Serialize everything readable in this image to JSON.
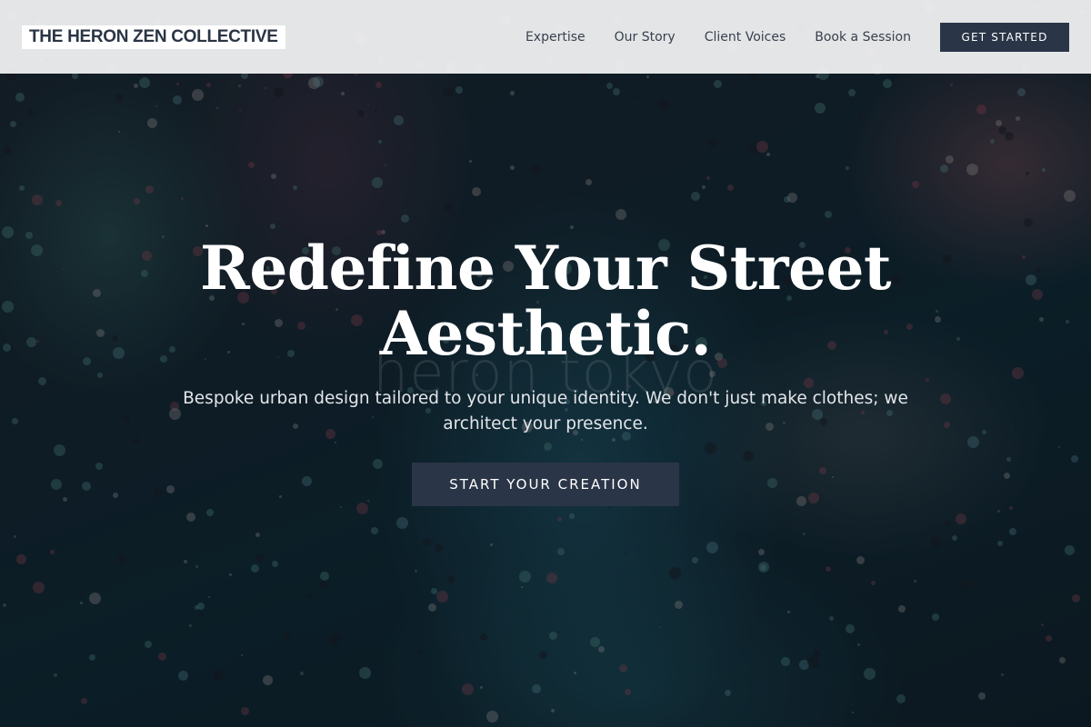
{
  "header": {
    "brand": "THE HERON ZEN COLLECTIVE",
    "nav": [
      {
        "label": "Expertise"
      },
      {
        "label": "Our Story"
      },
      {
        "label": "Client Voices"
      },
      {
        "label": "Book a Session"
      }
    ],
    "cta_label": "GET STARTED"
  },
  "hero": {
    "headline_line1": "Redefine Your Street",
    "headline_line2": "Aesthetic.",
    "watermark": "heron tokyo",
    "subtext": "Bespoke urban design tailored to your unique identity. We don't just make clothes; we architect your presence.",
    "cta_label": "START YOUR CREATION"
  },
  "colors": {
    "header_bg": "#f4f4f5",
    "button_bg": "#2a3547",
    "brand_text": "#2a3444",
    "nav_text": "#38414f",
    "headline": "#ffffff"
  }
}
